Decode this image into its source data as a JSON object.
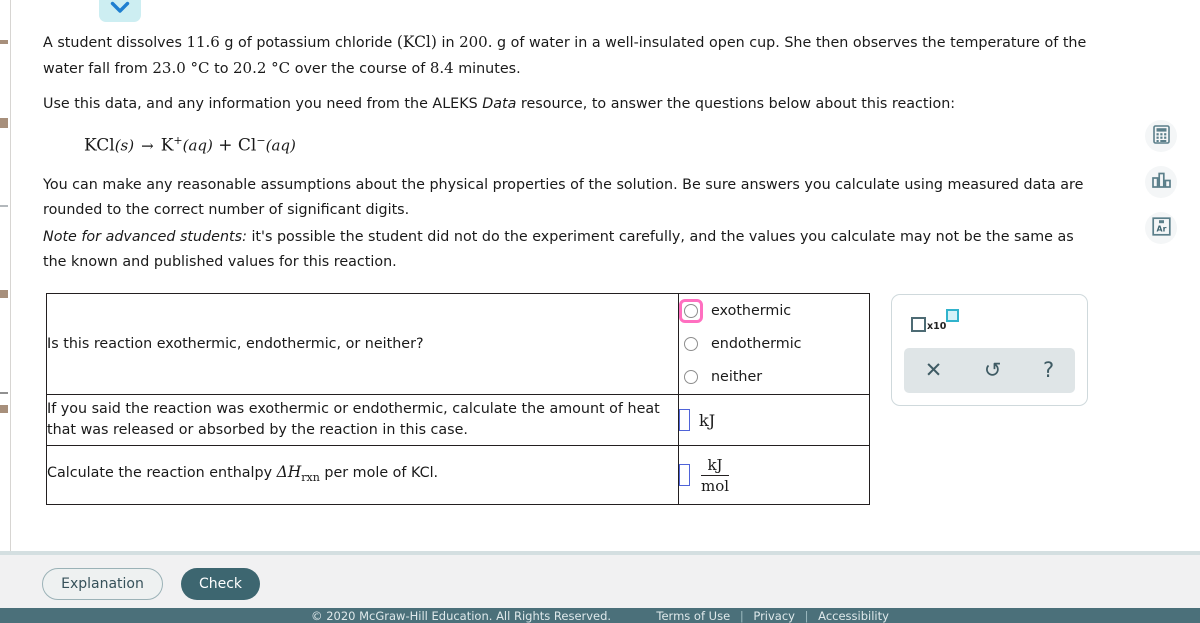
{
  "problem": {
    "paragraph_1": "A student dissolves 11.6 g of potassium chloride (KCl) in 200. g of water in a well-insulated open cup. She then observes the temperature of the water fall from 23.0 °C to 20.2 °C over the course of 8.4 minutes.",
    "p1_a": "A student dissolves",
    "p1_mass": "11.6",
    "p1_b": "g of potassium chloride",
    "p1_formula": "(KCl)",
    "p1_c": "in",
    "p1_water": "200.",
    "p1_d": "g of water in a well-insulated open cup. She then observes the temperature of the water fall from",
    "p1_t1": "23.0 °C",
    "p1_e": "to",
    "p1_t2": "20.2 °C",
    "p1_f": "over the course of",
    "p1_time": "8.4",
    "p1_g": "minutes.",
    "paragraph_2_a": "Use this data, and any information you need from the ALEKS",
    "paragraph_2_em": "Data",
    "paragraph_2_b": "resource, to answer the questions below about this reaction:",
    "paragraph_3": "You can make any reasonable assumptions about the physical properties of the solution. Be sure answers you calculate using measured data are rounded to the correct number of significant digits.",
    "paragraph_4_em": "Note for advanced students:",
    "paragraph_4": "it's possible the student did not do the experiment carefully, and the values you calculate may not be the same as the known and published values for this reaction."
  },
  "equation": {
    "reactant": "KCl",
    "reactant_state": "(s)",
    "arrow": "→",
    "product1": "K",
    "product1_charge": "+",
    "product1_state": "(aq)",
    "plus": "+",
    "product2": "Cl",
    "product2_charge": "−",
    "product2_state": "(aq)"
  },
  "table": {
    "rows": [
      {
        "question": "Is this reaction exothermic, endothermic, or neither?",
        "answer_type": "radio",
        "options": [
          {
            "label": "exothermic",
            "selected": false,
            "focused": true
          },
          {
            "label": "endothermic",
            "selected": false,
            "focused": false
          },
          {
            "label": "neither",
            "selected": false,
            "focused": false
          }
        ]
      },
      {
        "question": "If you said the reaction was exothermic or endothermic, calculate the amount of heat that was released or absorbed by the reaction in this case.",
        "answer_type": "entry",
        "value": "",
        "unit": "kJ"
      },
      {
        "question_a": "Calculate the reaction enthalpy",
        "question_symbol": "ΔH",
        "question_subscript": "rxn",
        "question_b": "per mole of KCl.",
        "answer_type": "entry-fraction",
        "value": "",
        "unit_numerator": "kJ",
        "unit_denominator": "mol"
      }
    ]
  },
  "math_toolbar": {
    "scientific_notation_label": "x10",
    "buttons": [
      {
        "name": "clear",
        "glyph": "✕"
      },
      {
        "name": "undo",
        "glyph": "↺"
      },
      {
        "name": "help",
        "glyph": "?"
      }
    ]
  },
  "tool_rail": [
    {
      "name": "calculator-icon",
      "label": "Calculator"
    },
    {
      "name": "bar-chart-icon",
      "label": "Data"
    },
    {
      "name": "periodic-table-icon",
      "label": "Ar"
    }
  ],
  "actions": {
    "explanation_label": "Explanation",
    "check_label": "Check"
  },
  "footer": {
    "copyright": "© 2020 McGraw-Hill Education. All Rights Reserved.",
    "terms": "Terms of Use",
    "privacy": "Privacy",
    "accessibility": "Accessibility",
    "separator": "|"
  },
  "colors": {
    "focus_ring": "#ff6fc0",
    "entry_border": "#4f63d8",
    "check_button": "#3d6670",
    "footer_bar": "#4b707a",
    "chevron_tab": "#cdeef2",
    "exponent_box": "#31b3cc"
  }
}
